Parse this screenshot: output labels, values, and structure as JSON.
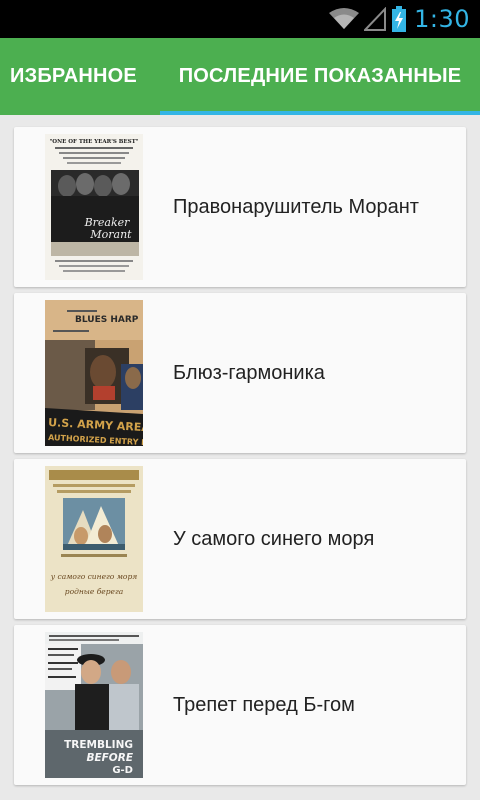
{
  "status_bar": {
    "time": "1:30"
  },
  "tabs": [
    {
      "label": "ИЗБРАННОЕ",
      "active": false
    },
    {
      "label": "ПОСЛЕДНИЕ ПОКАЗАННЫЕ",
      "active": true
    }
  ],
  "colors": {
    "accent": "#33b5e5",
    "toolbar": "#4caf50",
    "card": "#fafafa",
    "background": "#e9e9e9"
  },
  "movies": [
    {
      "title": "Правонарушитель Морант",
      "poster_icon": "breaker-morant-poster",
      "poster_text": {
        "tagline": "\"ONE OF THE YEAR'S BEST\"",
        "name_line1": "Breaker",
        "name_line2": "Morant"
      }
    },
    {
      "title": "Блюз-гармоника",
      "poster_icon": "blues-harp-poster",
      "poster_text": {
        "name": "BLUES HARP",
        "sign_line1": "U.S. ARMY AREA",
        "sign_line2": "AUTHORIZED ENTRY PROHIBI"
      }
    },
    {
      "title": "У самого синего моря",
      "poster_icon": "by-the-bluest-sea-poster",
      "poster_text": {
        "script_line1": "у самого синего моря",
        "script_line2": "родные берега"
      }
    },
    {
      "title": "Трепет перед Б-гом",
      "poster_icon": "trembling-before-god-poster",
      "poster_text": {
        "name_line1": "TREMBLING",
        "name_line2": "BEFORE",
        "name_line3": "G-D"
      }
    }
  ]
}
